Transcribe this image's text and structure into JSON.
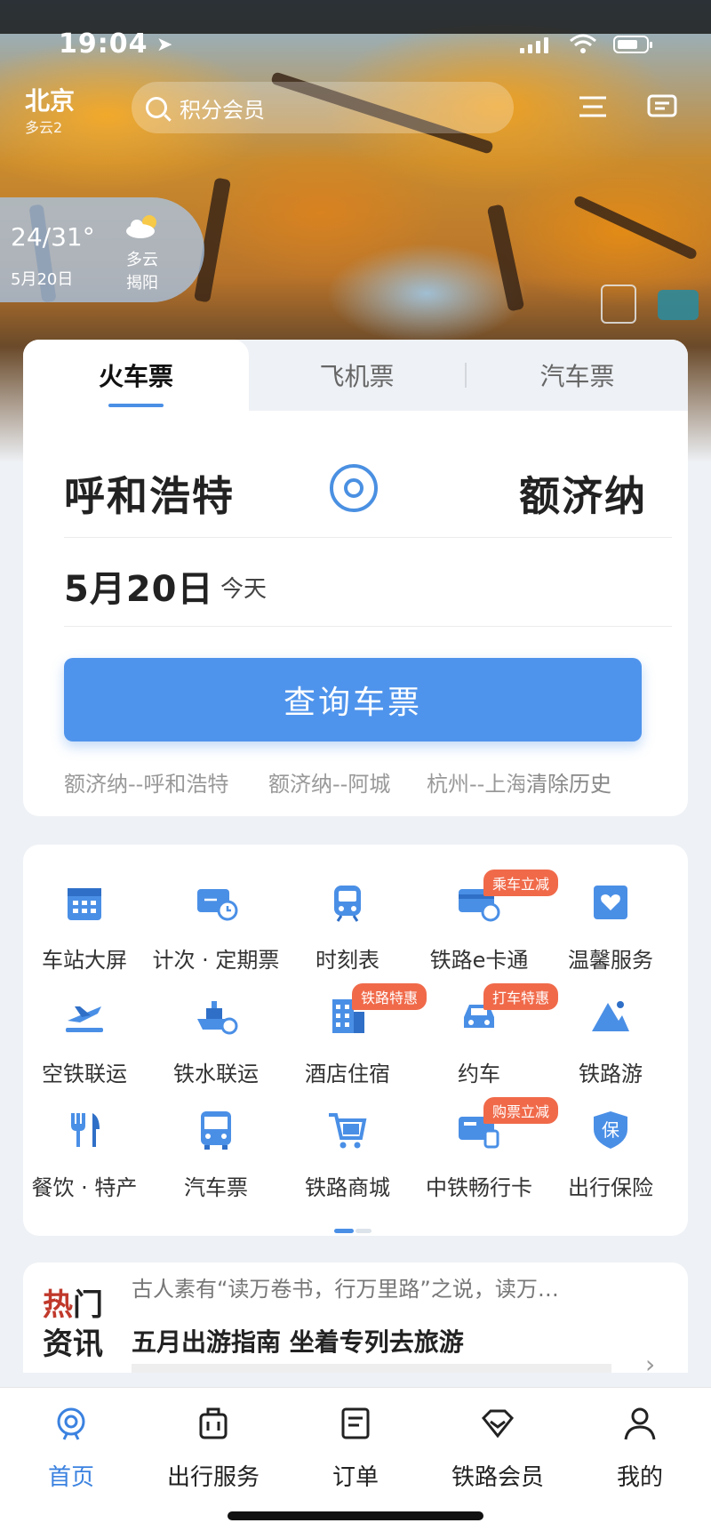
{
  "status_bar": {
    "time": "19:04"
  },
  "header": {
    "city": "北京",
    "city_weather": "多云2",
    "search_placeholder": "积分会员"
  },
  "weather_card": {
    "temp": "24/31°",
    "date": "5月20日",
    "condition": "多云",
    "place": "揭阳"
  },
  "ticket_tabs": [
    {
      "label": "火车票",
      "active": true
    },
    {
      "label": "飞机票",
      "active": false
    },
    {
      "label": "汽车票",
      "active": false
    }
  ],
  "route": {
    "from": "呼和浩特",
    "to": "额济纳"
  },
  "date": {
    "value": "5月20日",
    "relative": "今天"
  },
  "query_button": "查询车票",
  "history": [
    "额济纳--呼和浩特",
    "额济纳--阿城",
    "杭州--上海"
  ],
  "clear_history": "清除历史",
  "services": [
    {
      "label": "车站大屏",
      "icon": "calendar-icon"
    },
    {
      "label": "计次 · 定期票",
      "icon": "ticket-clock-icon"
    },
    {
      "label": "时刻表",
      "icon": "train-icon"
    },
    {
      "label": "铁路e卡通",
      "icon": "card-icon",
      "badge": "乘车立减"
    },
    {
      "label": "温馨服务",
      "icon": "heart-box-icon"
    },
    {
      "label": "空铁联运",
      "icon": "plane-icon"
    },
    {
      "label": "铁水联运",
      "icon": "ship-icon"
    },
    {
      "label": "酒店住宿",
      "icon": "hotel-icon",
      "badge": "铁路特惠"
    },
    {
      "label": "约车",
      "icon": "car-icon",
      "badge": "打车特惠"
    },
    {
      "label": "铁路游",
      "icon": "mountain-icon"
    },
    {
      "label": "餐饮 · 特产",
      "icon": "fork-knife-icon"
    },
    {
      "label": "汽车票",
      "icon": "bus-icon"
    },
    {
      "label": "铁路商城",
      "icon": "cart-icon"
    },
    {
      "label": "中铁畅行卡",
      "icon": "card-train-icon",
      "badge": "购票立减"
    },
    {
      "label": "出行保险",
      "icon": "shield-icon",
      "badge_text": "保"
    }
  ],
  "news": {
    "tag_line1_red": "热",
    "tag_line1": "门",
    "tag_line2": "资讯",
    "preview": "古人素有“读万卷书，行万里路”之说，读万…",
    "title": "五月出游指南 坐着专列去旅游"
  },
  "bottom_nav": [
    {
      "label": "首页",
      "icon": "home-train-icon",
      "active": true
    },
    {
      "label": "出行服务",
      "icon": "luggage-icon",
      "active": false
    },
    {
      "label": "订单",
      "icon": "order-icon",
      "active": false
    },
    {
      "label": "铁路会员",
      "icon": "diamond-icon",
      "active": false
    },
    {
      "label": "我的",
      "icon": "person-icon",
      "active": false
    }
  ],
  "colors": {
    "accent": "#4f94ec",
    "badge": "#f06a4a",
    "active_nav": "#3b82e0"
  }
}
